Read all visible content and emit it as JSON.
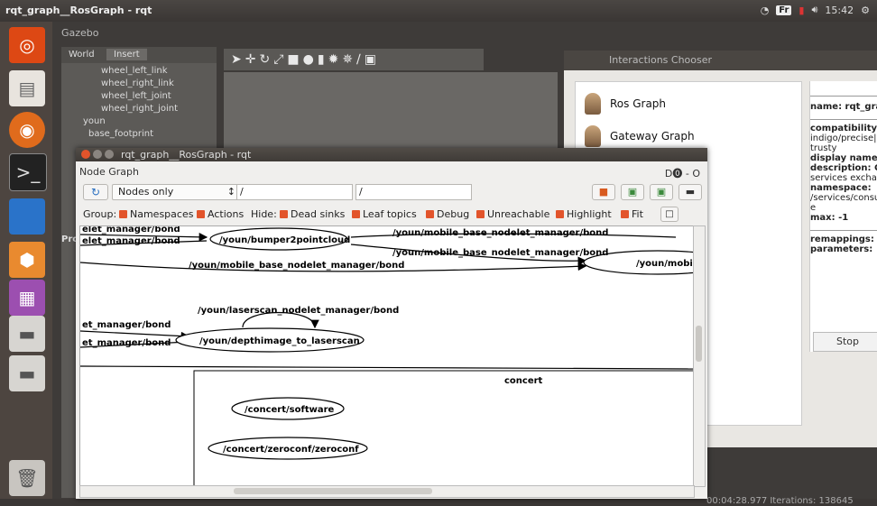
{
  "top_panel": {
    "title": "rqt_graph__RosGraph - rqt",
    "keyboard": "Fr",
    "clock": "15:42"
  },
  "gazebo": {
    "window_title": "Gazebo",
    "tabs": [
      "World",
      "Insert"
    ],
    "tree": [
      "wheel_left_link",
      "wheel_right_link",
      "wheel_left_joint",
      "wheel_right_joint",
      "youn",
      "base_footprint"
    ],
    "left_bottom_label": "Pro",
    "status": "00:04:28.977  Iterations:  138645"
  },
  "chooser": {
    "title": "Interactions Chooser",
    "items": [
      "Ros Graph",
      "Gateway Graph"
    ],
    "info": {
      "name_label": "name: rqt_grap",
      "compat_label": "compatibility:",
      "compat_value_1": "indigo/precise|",
      "compat_value_2": "trusty",
      "display_label": "display name:",
      "desc_label": "description: Gr",
      "desc_value": "services exchang",
      "ns_label": "namespace:",
      "ns_value": "/services/consu",
      "ns_value_2": "e",
      "max_label": "max: -1",
      "remap_label": "remappings: []",
      "params_label": "parameters:"
    },
    "stop_label": "Stop"
  },
  "rqt": {
    "title": "rqt_graph__RosGraph - rqt",
    "plugin_label": "Node Graph",
    "plugin_controls": "D⓿ - O",
    "view_mode": "Nodes only",
    "filter1": "/",
    "filter2": "/",
    "group_label": "Group:",
    "namespaces": "Namespaces",
    "actions": "Actions",
    "hide_label": "Hide:",
    "dead_sinks": "Dead sinks",
    "leaf_topics": "Leaf topics",
    "debug": "Debug",
    "unreachable": "Unreachable",
    "highlight": "Highlight",
    "fit": "Fit"
  },
  "graph": {
    "nodes": [
      "/youn/bumper2pointcloud",
      "/youn/mobile",
      "/youn/depthimage_to_laserscan",
      "/concert/software",
      "/concert/zeroconf/zeroconf"
    ],
    "edge_labels": [
      "elet_manager/bond",
      "elet_manager/bond",
      "/youn/mobile_base_nodelet_manager/bond",
      "/youn/mobile_base_nodelet_manager/bond",
      "/youn/mobile_base_nodelet_manager/bond",
      "/youn/laserscan_nodelet_manager/bond",
      "et_manager/bond",
      "et_manager/bond"
    ],
    "cluster_label": "concert"
  }
}
